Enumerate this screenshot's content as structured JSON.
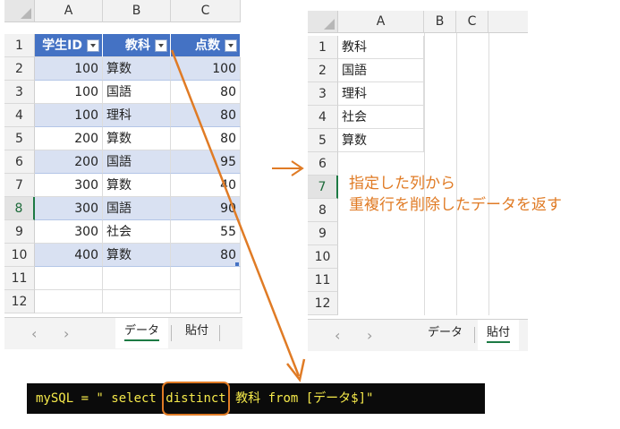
{
  "left_sheet": {
    "columns": [
      "A",
      "B",
      "C"
    ],
    "rows": [
      "1",
      "2",
      "3",
      "4",
      "5",
      "6",
      "7",
      "8",
      "9",
      "10",
      "11",
      "12"
    ],
    "selected_row": "8",
    "headers": [
      "学生ID",
      "教科",
      "点数"
    ],
    "data": [
      [
        "100",
        "算数",
        "100"
      ],
      [
        "100",
        "国語",
        "80"
      ],
      [
        "100",
        "理科",
        "80"
      ],
      [
        "200",
        "算数",
        "80"
      ],
      [
        "200",
        "国語",
        "95"
      ],
      [
        "300",
        "算数",
        "40"
      ],
      [
        "300",
        "国語",
        "90"
      ],
      [
        "300",
        "社会",
        "55"
      ],
      [
        "400",
        "算数",
        "80"
      ]
    ],
    "tabs": [
      "データ",
      "貼付"
    ],
    "active_tab": "データ"
  },
  "right_sheet": {
    "columns": [
      "A",
      "B",
      "C"
    ],
    "rows": [
      "1",
      "2",
      "3",
      "4",
      "5",
      "6",
      "7",
      "8",
      "9",
      "10",
      "11",
      "12"
    ],
    "selected_row": "7",
    "data": [
      "教科",
      "国語",
      "理科",
      "社会",
      "算数"
    ],
    "tabs": [
      "データ",
      "貼付"
    ],
    "active_tab": "貼付"
  },
  "annotation": {
    "line1": "指定した列から",
    "line2": "重複行を削除したデータを返す",
    "color": "#e07b25"
  },
  "code": {
    "before": "mySQL = \" select ",
    "keyword": "distinct",
    "after": " 教科 from [データ$]\""
  },
  "icons": {
    "nav_prev": "‹",
    "nav_next": "›"
  },
  "colors": {
    "table_header": "#4472c4",
    "table_band": "#d9e1f2",
    "excel_green": "#1d7a44"
  }
}
